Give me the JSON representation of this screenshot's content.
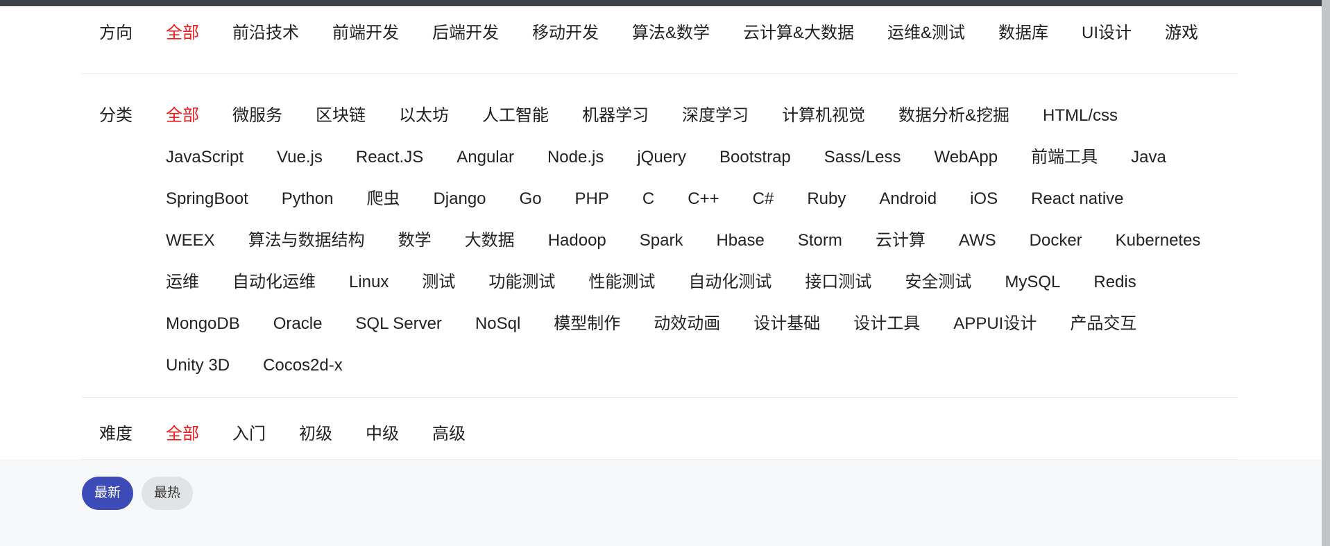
{
  "filters": {
    "direction": {
      "label": "方向",
      "items": [
        "全部",
        "前沿技术",
        "前端开发",
        "后端开发",
        "移动开发",
        "算法&数学",
        "云计算&大数据",
        "运维&测试",
        "数据库",
        "UI设计",
        "游戏"
      ],
      "active": "全部"
    },
    "category": {
      "label": "分类",
      "items": [
        "全部",
        "微服务",
        "区块链",
        "以太坊",
        "人工智能",
        "机器学习",
        "深度学习",
        "计算机视觉",
        "数据分析&挖掘",
        "HTML/css",
        "JavaScript",
        "Vue.js",
        "React.JS",
        "Angular",
        "Node.js",
        "jQuery",
        "Bootstrap",
        "Sass/Less",
        "WebApp",
        "前端工具",
        "Java",
        "SpringBoot",
        "Python",
        "爬虫",
        "Django",
        "Go",
        "PHP",
        "C",
        "C++",
        "C#",
        "Ruby",
        "Android",
        "iOS",
        "React native",
        "WEEX",
        "算法与数据结构",
        "数学",
        "大数据",
        "Hadoop",
        "Spark",
        "Hbase",
        "Storm",
        "云计算",
        "AWS",
        "Docker",
        "Kubernetes",
        "运维",
        "自动化运维",
        "Linux",
        "测试",
        "功能测试",
        "性能测试",
        "自动化测试",
        "接口测试",
        "安全测试",
        "MySQL",
        "Redis",
        "MongoDB",
        "Oracle",
        "SQL Server",
        "NoSql",
        "模型制作",
        "动效动画",
        "设计基础",
        "设计工具",
        "APPUI设计",
        "产品交互",
        "Unity 3D",
        "Cocos2d-x"
      ],
      "active": "全部"
    },
    "level": {
      "label": "难度",
      "items": [
        "全部",
        "入门",
        "初级",
        "中级",
        "高级"
      ],
      "active": "全部"
    }
  },
  "sort": {
    "newest": "最新",
    "hottest": "最热",
    "selected": "最新"
  },
  "colors": {
    "active_text": "#ee1c1c",
    "sort_selected_bg": "#3d4bb9",
    "topbar": "#3c4249"
  }
}
